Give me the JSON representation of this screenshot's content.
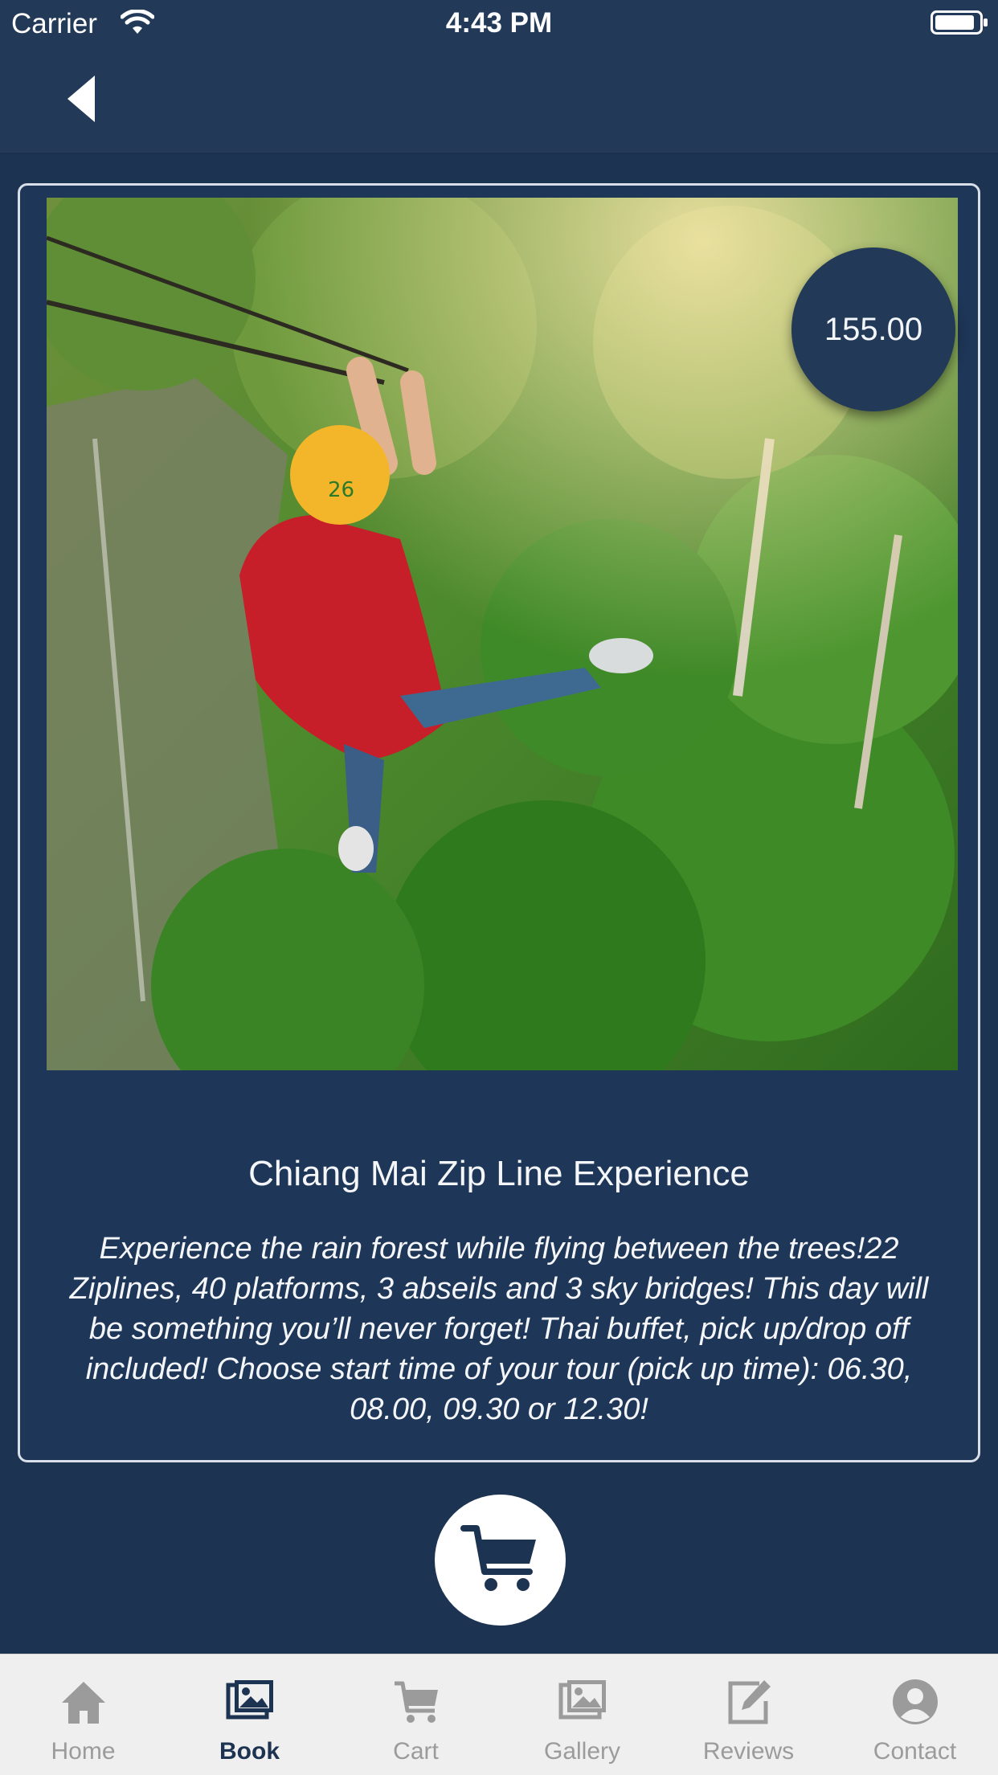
{
  "status_bar": {
    "carrier": "Carrier",
    "time": "4:43 PM"
  },
  "nav": {
    "back_icon": "chevron-left-icon"
  },
  "tour": {
    "price": "155.00",
    "title": "Chiang Mai Zip Line Experience",
    "description": "Experience the rain forest while flying between the trees!22 Ziplines, 40 platforms, 3 abseils and 3 sky bridges! This day will be something you’ll never forget! Thai buffet, pick up/drop off included! Choose start time of your tour (pick up time): 06.30, 08.00, 09.30 or 12.30!"
  },
  "cart_button_icon": "cart-icon",
  "tabs": [
    {
      "label": "Home",
      "icon": "home-icon",
      "active": false
    },
    {
      "label": "Book",
      "icon": "book-icon",
      "active": true
    },
    {
      "label": "Cart",
      "icon": "cart-icon",
      "active": false
    },
    {
      "label": "Gallery",
      "icon": "gallery-icon",
      "active": false
    },
    {
      "label": "Reviews",
      "icon": "reviews-icon",
      "active": false
    },
    {
      "label": "Contact",
      "icon": "contact-icon",
      "active": false
    }
  ],
  "colors": {
    "background": "#1d3352",
    "bar": "#223a58",
    "tab_active": "#1d3352",
    "tab_inactive": "#9b9b9b"
  }
}
